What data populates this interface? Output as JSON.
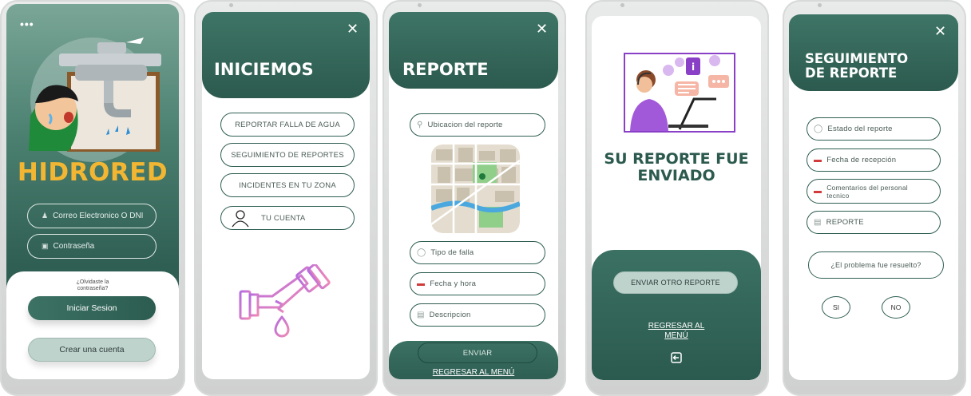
{
  "colors": {
    "primary": "#2f5e53",
    "brand_yellow": "#f2b632",
    "light_green": "#bfd3cd"
  },
  "screen1": {
    "menu_icon": "more-dots-icon",
    "brand": "HIDRORED",
    "email_placeholder": "Correo Electronico O DNI",
    "password_placeholder": "Contraseña",
    "forgot_line1": "¿Olvidaste la",
    "forgot_line2": "contraseña?",
    "login_button": "Iniciar Sesion",
    "create_button": "Crear una cuenta"
  },
  "screen2": {
    "title": "INICIEMOS",
    "options": [
      "REPORTAR FALLA DE AGUA",
      "SEGUIMIENTO DE REPORTES",
      "INCIDENTES EN TU ZONA",
      "TU CUENTA"
    ]
  },
  "screen3": {
    "title": "REPORTE",
    "location_placeholder": "Ubicacion del reporte",
    "fault_type_placeholder": "Tipo de falla",
    "datetime_placeholder": "Fecha y hora",
    "description_placeholder": "Descripcion",
    "send_button": "ENVIAR",
    "back_link": "REGRESAR AL MENÚ"
  },
  "screen4": {
    "message_line1": "SU REPORTE FUE",
    "message_line2": "ENVIADO",
    "another_button": "ENVIAR OTRO REPORTE",
    "back_line1": "REGRESAR AL",
    "back_line2": "MENÚ"
  },
  "screen5": {
    "title_line1": "SEGUIMIENTO",
    "title_line2": "DE REPORTE",
    "status_placeholder": "Estado del reporte",
    "reception_date_placeholder": "Fecha de recepción",
    "comments_line1": "Comentarios del personal",
    "comments_line2": "tecnico",
    "report_placeholder": "REPORTE",
    "resolved_question": "¿El problema fue resuelto?",
    "yes_label": "SI",
    "no_label": "NO"
  }
}
